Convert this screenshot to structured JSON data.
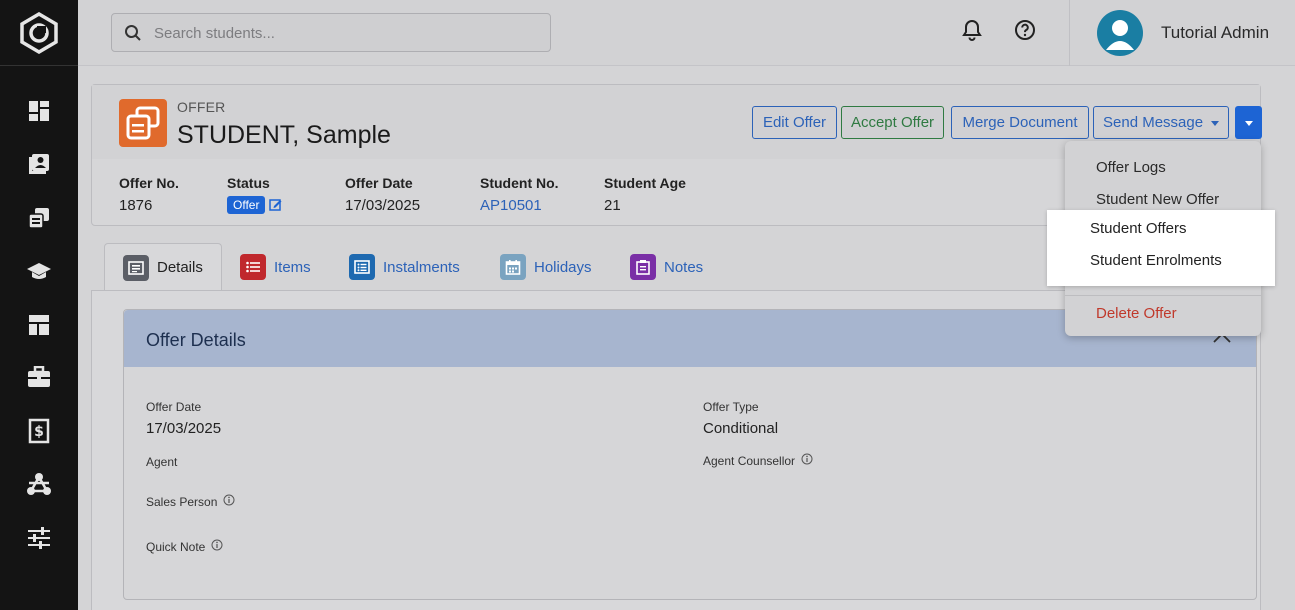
{
  "search": {
    "placeholder": "Search students..."
  },
  "user": {
    "name": "Tutorial Admin"
  },
  "sidebar": {
    "items": [
      {
        "icon": "dashboard-icon"
      },
      {
        "icon": "students-icon"
      },
      {
        "icon": "offers-icon"
      },
      {
        "icon": "courses-icon"
      },
      {
        "icon": "layout-icon"
      },
      {
        "icon": "briefcase-icon"
      },
      {
        "icon": "finance-icon"
      },
      {
        "icon": "network-icon"
      },
      {
        "icon": "settings-sliders-icon"
      }
    ]
  },
  "offer": {
    "kicker": "OFFER",
    "title": "STUDENT, Sample"
  },
  "actions": {
    "edit": "Edit Offer",
    "accept": "Accept Offer",
    "merge": "Merge Document",
    "send": "Send Message"
  },
  "fields": {
    "offer_no": {
      "label": "Offer No.",
      "value": "1876"
    },
    "status": {
      "label": "Status",
      "value": "Offer"
    },
    "offer_date": {
      "label": "Offer Date",
      "value": "17/03/2025"
    },
    "student_no": {
      "label": "Student No.",
      "value": "AP10501"
    },
    "student_age": {
      "label": "Student Age",
      "value": "21"
    }
  },
  "tabs": [
    {
      "label": "Details",
      "color": "#5b5e66"
    },
    {
      "label": "Items",
      "color": "#c0282d"
    },
    {
      "label": "Instalments",
      "color": "#1e69b0"
    },
    {
      "label": "Holidays",
      "color": "#7aa3c0"
    },
    {
      "label": "Notes",
      "color": "#7a2fa6"
    }
  ],
  "details": {
    "title": "Offer Details",
    "offer_date": {
      "label": "Offer Date",
      "value": "17/03/2025"
    },
    "offer_type": {
      "label": "Offer Type",
      "value": "Conditional"
    },
    "agent": {
      "label": "Agent"
    },
    "agent_counsellor": {
      "label": "Agent Counsellor"
    },
    "sales_person": {
      "label": "Sales Person"
    },
    "quick_note": {
      "label": "Quick Note"
    }
  },
  "menu": {
    "items": [
      "Offer Logs",
      "Student New Offer"
    ],
    "highlighted": [
      "Student Offers",
      "Student Enrolments"
    ],
    "danger": "Delete Offer"
  }
}
